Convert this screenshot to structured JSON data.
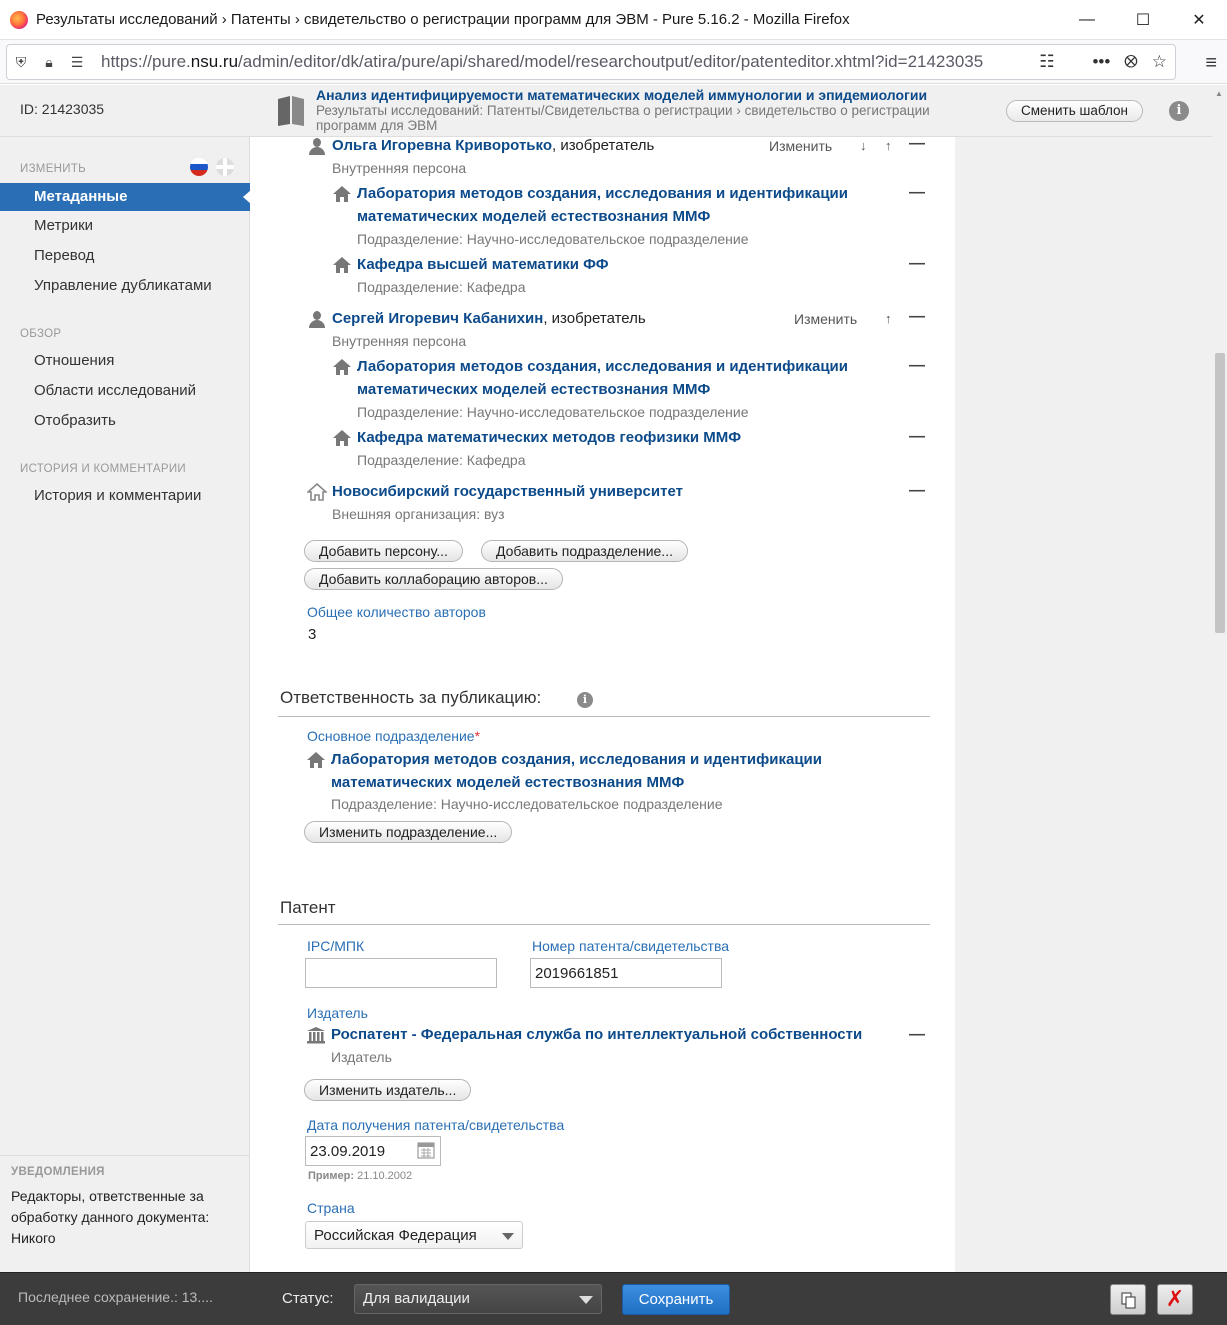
{
  "browser": {
    "window_title": "Результаты исследований › Патенты › свидетельство о регистрации программ для ЭВМ - Pure 5.16.2 - Mozilla Firefox",
    "url_prefix": "https://pure.",
    "url_domain": "nsu.ru",
    "url_rest": "/admin/editor/dk/atira/pure/api/shared/model/researchoutput/editor/patenteditor.xhtml?id=21423035"
  },
  "header": {
    "id_label": "ID: 21423035",
    "doc_title": "Анализ идентифицируемости математических моделей иммунологии и эпидемиологии",
    "doc_path": "Результаты исследований: Патенты/Свидетельства о регистрации › свидетельство о регистрации программ для ЭВМ",
    "template_button": "Сменить шаблон",
    "info_icon_label": "i"
  },
  "sidebar": {
    "edit_heading": "ИЗМЕНИТЬ",
    "edit_items": [
      "Метаданные",
      "Метрики",
      "Перевод",
      "Управление дубликатами"
    ],
    "overview_heading": "ОБЗОР",
    "overview_items": [
      "Отношения",
      "Области исследований",
      "Отобразить"
    ],
    "history_heading": "ИСТОРИЯ И КОММЕНТАРИИ",
    "history_items": [
      "История и комментарии"
    ],
    "notifications": {
      "heading": "УВЕДОМЛЕНИЯ",
      "text": "Редакторы, ответственные за обработку данного документа: Никого"
    }
  },
  "authors": {
    "edit_label": "Изменить",
    "persons": [
      {
        "name": "Ольга Игоревна Криворотько",
        "role": ", изобретатель",
        "type": "Внутренняя персона",
        "orgs": [
          {
            "name": "Лаборатория методов создания, исследования и идентификации математических моделей естествознания ММФ",
            "type": "Подразделение: Научно-исследовательское подразделение"
          },
          {
            "name": "Кафедра высшей математики ФФ",
            "type": "Подразделение: Кафедра"
          }
        ]
      },
      {
        "name": "Сергей Игоревич Кабанихин",
        "role": ", изобретатель",
        "type": "Внутренняя персона",
        "orgs": [
          {
            "name": "Лаборатория методов создания, исследования и идентификации математических моделей естествознания ММФ",
            "type": "Подразделение: Научно-исследовательское подразделение"
          },
          {
            "name": "Кафедра математических методов геофизики ММФ",
            "type": "Подразделение: Кафедра"
          }
        ]
      }
    ],
    "external_org": {
      "name": "Новосибирский государственный университет",
      "type": "Внешняя организация: вуз"
    },
    "buttons": {
      "add_person": "Добавить персону...",
      "add_org": "Добавить подразделение...",
      "add_collab": "Добавить коллаборацию авторов..."
    },
    "total_label": "Общее количество авторов",
    "total_value": "3"
  },
  "responsibility": {
    "title": "Ответственность за публикацию:",
    "main_org_label": "Основное подразделение",
    "required_mark": "*",
    "org_name": "Лаборатория методов создания, исследования и идентификации математических моделей естествознания ММФ",
    "org_type": "Подразделение: Научно-исследовательское подразделение",
    "change_button": "Изменить подразделение..."
  },
  "patent": {
    "title": "Патент",
    "ipc_label": "IPC/МПК",
    "ipc_value": "",
    "number_label": "Номер патента/свидетельства",
    "number_value": "2019661851",
    "publisher_label": "Издатель",
    "publisher_name": "Роспатент - Федеральная служба по интеллектуальной собственности",
    "publisher_type": "Издатель",
    "change_publisher_button": "Изменить издатель...",
    "date_label": "Дата получения патента/свидетельства",
    "date_value": "23.09.2019",
    "date_example_prefix": "Пример:",
    "date_example_value": "21.10.2002",
    "country_label": "Страна",
    "country_value": "Российская Федерация"
  },
  "footer": {
    "last_saved": "Последнее сохранение.: 13....",
    "status_label": "Статус:",
    "status_value": "Для валидации",
    "save_button": "Сохранить",
    "close_glyph": "✗"
  }
}
